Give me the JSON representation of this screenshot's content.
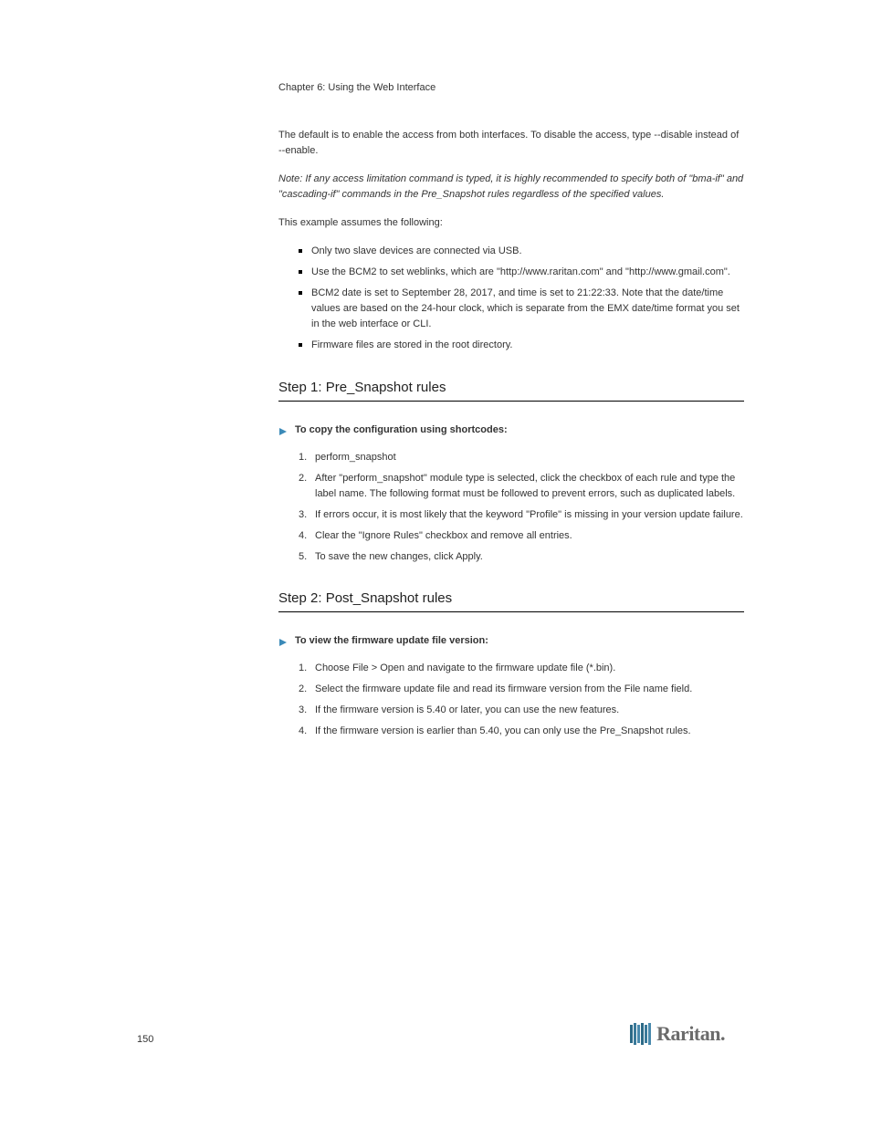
{
  "chapter_header": "Chapter 6: Using the Web Interface",
  "intro_paragraph_1": "The default is to enable the access from both interfaces. To disable the access, type --disable instead of --enable.",
  "intro_paragraph_2_prefix": "Note: If any access limitation command is typed, it is highly recommended to",
  "intro_paragraph_2_middle": "specify both of \"bma-if\" and \"cascading-if\" commands in the Pre_Snapshot",
  "intro_paragraph_2_end": "rules regardless of the specified values.",
  "config_copy_intro": "This example assumes the following:",
  "config_copy_items": [
    "Only two slave devices are connected via USB.",
    "Use the BCM2 to set weblinks, which are \"http://www.raritan.com\" and \"http://www.gmail.com\".",
    "BCM2 date is set to September 28, 2017, and time is set to 21:22:33. Note that the date/time values are based on the 24-hour clock, which is separate from the EMX date/time format you set in the web interface or CLI.",
    "Firmware files are stored in the root directory."
  ],
  "section1_heading": "Step 1: Pre_Snapshot rules",
  "section1_proc_label": "To copy the configuration using shortcodes:",
  "section1_items": [
    "perform_snapshot",
    "After \"perform_snapshot\" module type is selected, click the checkbox of each rule and type the label name. The following format must be followed to prevent errors, such as duplicated labels.",
    "If errors occur, it is most likely that the keyword \"Profile\" is missing in your version update failure.",
    "Clear the \"Ignore Rules\" checkbox and remove all entries.",
    "To save the new changes, click Apply."
  ],
  "section2_heading": "Step 2: Post_Snapshot rules",
  "section2_proc_label": "To view the firmware update file version:",
  "section2_items": [
    "Choose File > Open and navigate to the firmware update file (*.bin).",
    "Select the firmware update file and read its firmware version from the File name field.",
    "If the firmware version is 5.40 or later, you can use the new features.",
    "If the firmware version is earlier than 5.40, you can only use the Pre_Snapshot rules."
  ],
  "page_number": "150",
  "logo_text": "Raritan."
}
